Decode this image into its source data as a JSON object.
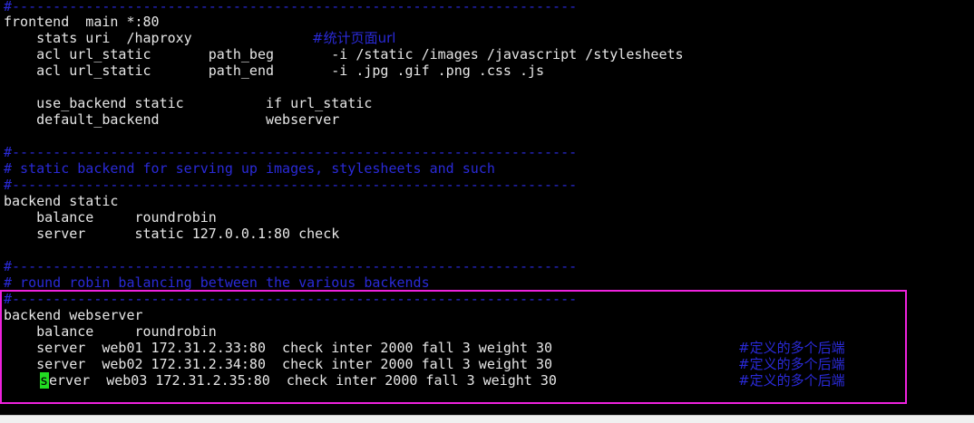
{
  "terminal": {
    "lines": [
      "#---------------------------------------------------------------------",
      "frontend  main *:80",
      "    stats uri  /haproxy",
      "    acl url_static       path_beg       -i /static /images /javascript /stylesheets",
      "    acl url_static       path_end       -i .jpg .gif .png .css .js",
      "",
      "    use_backend static          if url_static",
      "    default_backend             webserver",
      "",
      "#---------------------------------------------------------------------",
      "# static backend for serving up images, stylesheets and such",
      "#---------------------------------------------------------------------",
      "backend static",
      "    balance     roundrobin",
      "    server      static 127.0.0.1:80 check",
      "",
      "#---------------------------------------------------------------------",
      "# round robin balancing between the various backends",
      "#---------------------------------------------------------------------",
      "backend webserver",
      "    balance     roundrobin",
      "    server  web01 172.31.2.33:80  check inter 2000 fall 3 weight 30",
      "    server  web02 172.31.2.34:80  check inter 2000 fall 3 weight 30",
      "erver  web03 172.31.2.35:80  check inter 2000 fall 3 weight 30"
    ],
    "cursor_char": "s",
    "comments": {
      "stats_uri": "#统计页面url",
      "web01": "#定义的多个后端",
      "web02": "#定义的多个后端",
      "web03": "#定义的多个后端"
    },
    "colors": {
      "background": "#000000",
      "text": "#e6e6e6",
      "comment": "#2a2ad8",
      "cursor": "#22dd22",
      "highlight_box": "#ee22dd"
    }
  }
}
